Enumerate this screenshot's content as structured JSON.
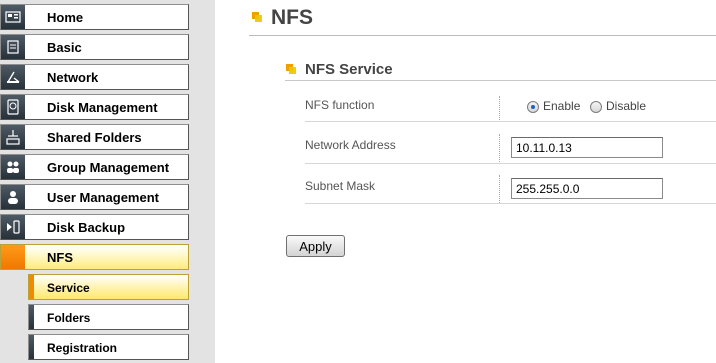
{
  "sidebar": {
    "items": [
      {
        "label": "Home",
        "icon": "home-icon"
      },
      {
        "label": "Basic",
        "icon": "document-icon"
      },
      {
        "label": "Network",
        "icon": "network-icon"
      },
      {
        "label": "Disk Management",
        "icon": "disk-icon"
      },
      {
        "label": "Shared Folders",
        "icon": "shared-folder-icon"
      },
      {
        "label": "Group Management",
        "icon": "group-icon"
      },
      {
        "label": "User Management",
        "icon": "user-icon"
      },
      {
        "label": "Disk Backup",
        "icon": "backup-icon"
      },
      {
        "label": "NFS",
        "icon": "nfs-icon",
        "active": true
      }
    ],
    "sub_items": [
      {
        "label": "Service",
        "active": true
      },
      {
        "label": "Folders"
      },
      {
        "label": "Registration"
      }
    ]
  },
  "main": {
    "page_title": "NFS",
    "section_title": "NFS Service",
    "nfs_function": {
      "label": "NFS function",
      "options": [
        "Enable",
        "Disable"
      ],
      "selected": "Enable"
    },
    "network_address": {
      "label": "Network Address",
      "value": "10.11.0.13"
    },
    "subnet_mask": {
      "label": "Subnet Mask",
      "value": "255.255.0.0"
    },
    "apply_label": "Apply"
  },
  "colors": {
    "accent_orange": "#f28a00",
    "active_yellow": "#ffec7a",
    "icon_dark": "#27313a"
  }
}
